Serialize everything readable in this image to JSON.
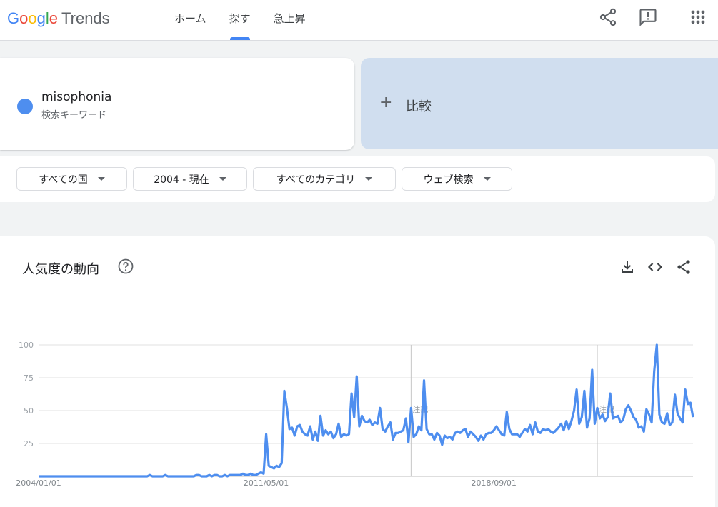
{
  "header": {
    "logo_google": "Google",
    "logo_trends": "Trends",
    "nav": [
      {
        "label": "ホーム",
        "active": false
      },
      {
        "label": "探す",
        "active": true
      },
      {
        "label": "急上昇",
        "active": false
      }
    ],
    "icons": [
      "share-icon",
      "feedback-icon",
      "apps-icon"
    ]
  },
  "search": {
    "term": "misophonia",
    "term_type": "検索キーワード",
    "term_color": "#4e8eef",
    "compare_label": "比較"
  },
  "filters": {
    "region": "すべての国",
    "time": "2004 - 現在",
    "category": "すべてのカテゴリ",
    "property": "ウェブ検索"
  },
  "chart_section": {
    "title": "人気度の動向",
    "icons": [
      "help-icon",
      "download-icon",
      "embed-icon",
      "share-icon"
    ]
  },
  "chart_data": {
    "type": "line",
    "series": [
      {
        "name": "misophonia",
        "color": "#4285f4"
      }
    ],
    "y_ticks": [
      "100",
      "75",
      "50",
      "25"
    ],
    "ylim": [
      0,
      100
    ],
    "x_tick_labels": [
      "2004/01/01",
      "2011/05/01",
      "2018/09/01"
    ],
    "annotations": [
      "注記"
    ],
    "grid": true,
    "yearly_points": [
      {
        "year": 2004,
        "values": [
          0,
          0,
          0,
          0,
          0,
          0,
          0,
          0,
          0,
          0,
          0,
          0
        ]
      },
      {
        "year": 2005,
        "values": [
          0,
          0,
          0,
          0,
          0,
          0,
          0,
          0,
          0,
          0,
          0,
          0
        ]
      },
      {
        "year": 2006,
        "values": [
          0,
          0,
          0,
          0,
          0,
          0,
          0,
          0,
          0,
          0,
          0,
          0
        ]
      },
      {
        "year": 2007,
        "values": [
          0,
          0,
          0,
          0,
          0,
          0,
          0,
          1,
          0,
          0,
          0,
          0
        ]
      },
      {
        "year": 2008,
        "values": [
          0,
          1,
          0,
          0,
          0,
          0,
          0,
          0,
          0,
          0,
          0,
          0
        ]
      },
      {
        "year": 2009,
        "values": [
          0,
          1,
          1,
          0,
          0,
          0,
          1,
          0,
          1,
          1,
          0,
          0
        ]
      },
      {
        "year": 2010,
        "values": [
          1,
          0,
          1,
          1,
          1,
          1,
          1,
          2,
          1,
          1,
          2,
          1
        ]
      },
      {
        "year": 2011,
        "values": [
          1,
          2,
          3,
          2,
          32,
          8,
          7,
          6,
          8,
          7,
          10,
          65
        ]
      },
      {
        "year": 2012,
        "values": [
          52,
          36,
          37,
          31,
          38,
          39,
          34,
          32,
          31,
          38,
          28,
          34
        ]
      },
      {
        "year": 2013,
        "values": [
          27,
          46,
          31,
          35,
          32,
          34,
          29,
          32,
          40,
          30,
          32,
          31
        ]
      },
      {
        "year": 2014,
        "values": [
          32,
          63,
          45,
          76,
          38,
          46,
          42,
          41,
          43,
          39,
          41,
          40
        ]
      },
      {
        "year": 2015,
        "values": [
          52,
          36,
          34,
          38,
          41,
          28,
          33,
          33,
          34,
          35,
          44,
          26
        ]
      },
      {
        "year": 2016,
        "values": [
          52,
          30,
          32,
          38,
          35,
          73,
          36,
          32,
          32,
          28,
          33,
          31
        ]
      },
      {
        "year": 2017,
        "values": [
          24,
          31,
          29,
          30,
          28,
          33,
          34,
          33,
          35,
          36,
          30,
          34
        ]
      },
      {
        "year": 2018,
        "values": [
          32,
          30,
          27,
          31,
          28,
          32,
          33,
          33,
          35,
          38,
          35,
          32
        ]
      },
      {
        "year": 2019,
        "values": [
          31,
          49,
          36,
          32,
          32,
          32,
          30,
          33,
          36,
          34,
          39,
          32
        ]
      },
      {
        "year": 2020,
        "values": [
          41,
          34,
          33,
          36,
          35,
          36,
          34,
          33,
          35,
          37,
          40,
          35
        ]
      },
      {
        "year": 2021,
        "values": [
          42,
          36,
          42,
          50,
          66,
          40,
          45,
          65,
          37,
          44,
          81,
          40
        ]
      },
      {
        "year": 2022,
        "values": [
          52,
          44,
          47,
          42,
          45,
          63,
          44,
          45,
          46,
          41,
          43,
          51
        ]
      },
      {
        "year": 2023,
        "values": [
          54,
          50,
          45,
          43,
          37,
          38,
          34,
          51,
          47,
          41,
          80,
          100
        ]
      },
      {
        "year": 2024,
        "values": [
          47,
          41,
          40,
          48,
          39,
          41,
          62,
          48,
          44,
          41,
          66,
          55
        ]
      },
      {
        "year": 2025,
        "values": [
          56,
          45
        ]
      }
    ]
  }
}
